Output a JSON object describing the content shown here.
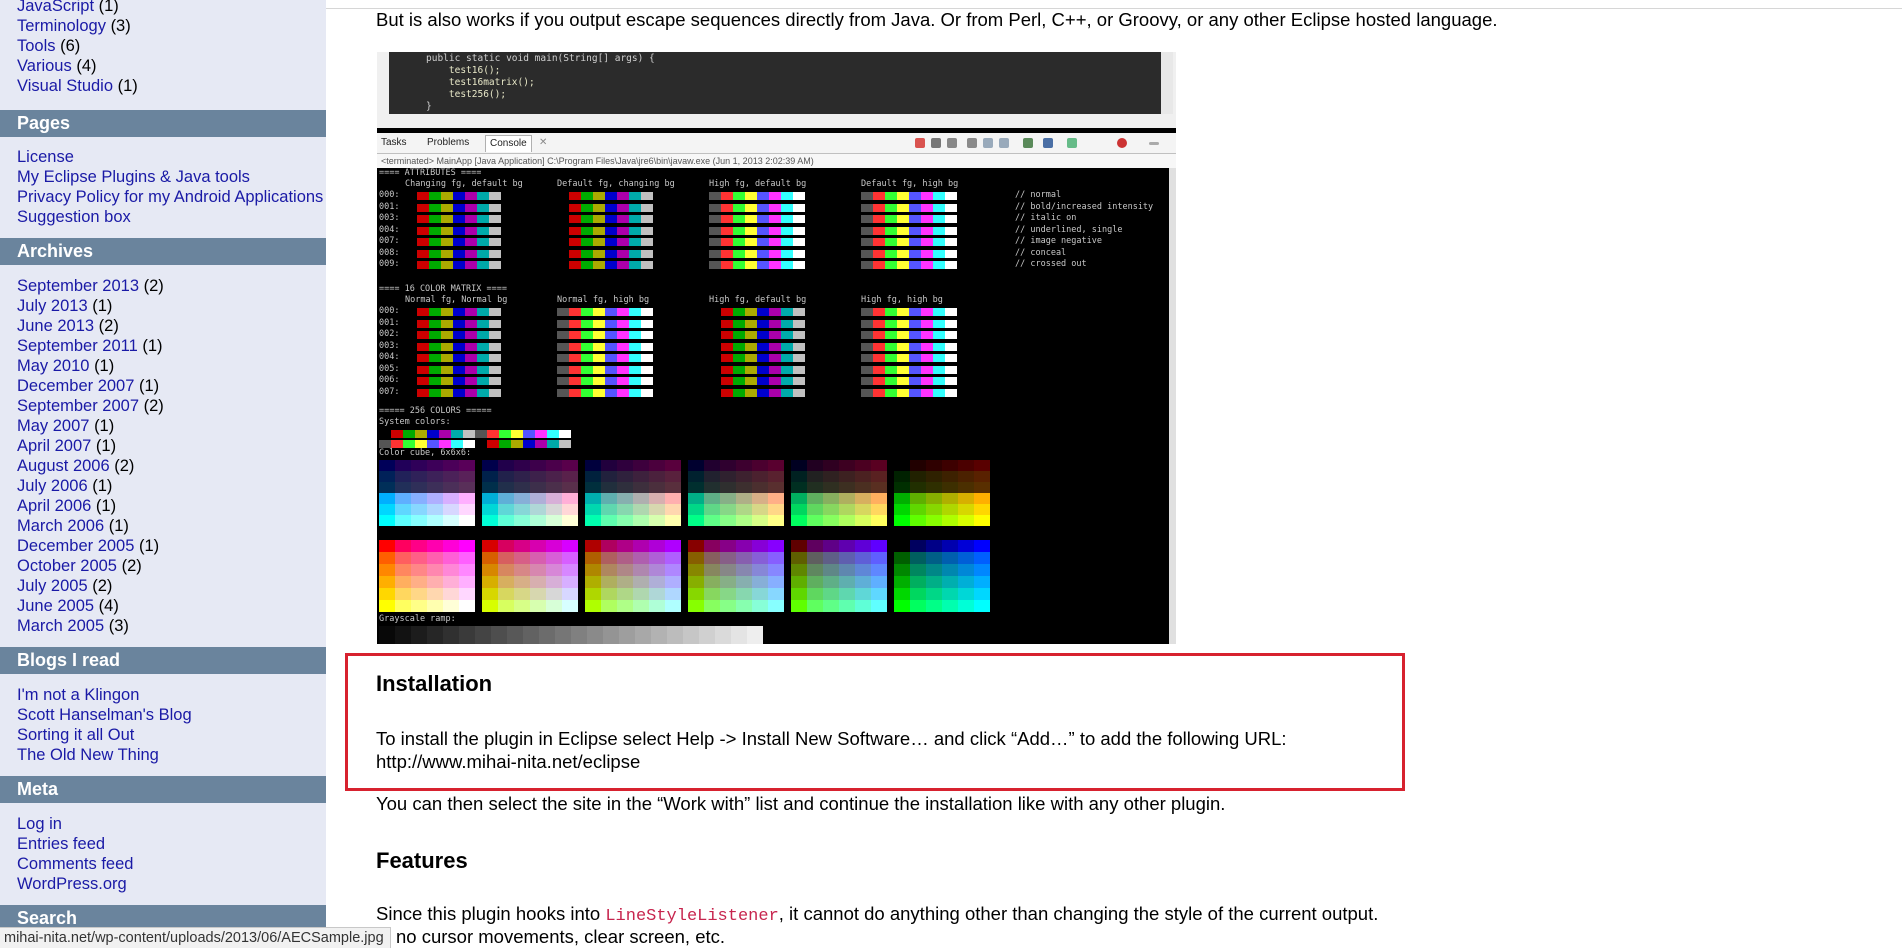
{
  "sidebar": {
    "categories": [
      {
        "label": "JavaScript",
        "count": "(1)"
      },
      {
        "label": "Terminology",
        "count": "(3)"
      },
      {
        "label": "Tools",
        "count": "(6)"
      },
      {
        "label": "Various",
        "count": "(4)"
      },
      {
        "label": "Visual Studio",
        "count": "(1)"
      }
    ],
    "pages_heading": "Pages",
    "pages": [
      {
        "label": "License"
      },
      {
        "label": "My Eclipse Plugins & Java tools"
      },
      {
        "label": "Privacy Policy for my Android Applications"
      },
      {
        "label": "Suggestion box"
      }
    ],
    "archives_heading": "Archives",
    "archives": [
      {
        "label": "September 2013",
        "count": "(2)"
      },
      {
        "label": "July 2013",
        "count": "(1)"
      },
      {
        "label": "June 2013",
        "count": "(2)"
      },
      {
        "label": "September 2011",
        "count": "(1)"
      },
      {
        "label": "May 2010",
        "count": "(1)"
      },
      {
        "label": "December 2007",
        "count": "(1)"
      },
      {
        "label": "September 2007",
        "count": "(2)"
      },
      {
        "label": "May 2007",
        "count": "(1)"
      },
      {
        "label": "April 2007",
        "count": "(1)"
      },
      {
        "label": "August 2006",
        "count": "(2)"
      },
      {
        "label": "July 2006",
        "count": "(1)"
      },
      {
        "label": "April 2006",
        "count": "(1)"
      },
      {
        "label": "March 2006",
        "count": "(1)"
      },
      {
        "label": "December 2005",
        "count": "(1)"
      },
      {
        "label": "October 2005",
        "count": "(2)"
      },
      {
        "label": "July 2005",
        "count": "(2)"
      },
      {
        "label": "June 2005",
        "count": "(4)"
      },
      {
        "label": "March 2005",
        "count": "(3)"
      }
    ],
    "blogs_heading": "Blogs I read",
    "blogs": [
      {
        "label": "I'm not a Klingon"
      },
      {
        "label": "Scott Hanselman's Blog"
      },
      {
        "label": "Sorting it all Out"
      },
      {
        "label": "The Old New Thing"
      }
    ],
    "meta_heading": "Meta",
    "meta": [
      {
        "label": "Log in"
      },
      {
        "label": "Entries feed"
      },
      {
        "label": "Comments feed"
      },
      {
        "label": "WordPress.org"
      }
    ],
    "search_heading": "Search"
  },
  "status_url": "mihai-nita.net/wp-content/uploads/2013/06/AECSample.jpg",
  "content": {
    "intro": "But is also works if you output escape sequences directly from Java. Or from Perl, C++, or Groovy, or any other Eclipse hosted language.",
    "installation_heading": "Installation",
    "install_text_1": "To install the plugin in Eclipse select Help -> Install New Software… and click “Add…” to add the following URL:",
    "install_url": "http://www.mihai-nita.net/eclipse",
    "install_text_2": "You can then select the site in the “Work with” list and continue the installation like with any other plugin.",
    "features_heading": "Features",
    "features_pre": "Since this plugin hooks into ",
    "features_code": "LineStyleListener",
    "features_post": ", it cannot do anything other than changing the style of the current output.",
    "features_line2": "no cursor movements, clear screen, etc."
  },
  "screenshot": {
    "code_lines": [
      "public static void main(String[] args) {",
      "    test16();",
      "    test16matrix();",
      "    test256();",
      "}"
    ],
    "tabs": [
      "Tasks",
      "Problems",
      "Console"
    ],
    "terminated": "<terminated> MainApp [Java Application] C:\\Program Files\\Java\\jre6\\bin\\javaw.exe (Jun 1, 2013 2:02:39 AM)",
    "attributes_header": "==== ATTRIBUTES ====",
    "attr_col_titles": [
      "Changing fg, default bg",
      "Default fg, changing bg",
      "High fg, default bg",
      "Default fg, high bg"
    ],
    "row_labels": [
      "000:",
      "001:",
      "003:",
      "004:",
      "007:",
      "008:",
      "009:"
    ],
    "attr_comments": [
      "// normal",
      "// bold/increased intensity",
      "// italic on",
      "// underlined, single",
      "// image negative",
      "// conceal",
      "// crossed out"
    ],
    "matrix_header": "==== 16 COLOR MATRIX ====",
    "matrix_col_titles": [
      "Normal fg, Normal bg",
      "Normal fg, high bg",
      "High fg, default bg",
      "High fg, high bg"
    ],
    "matrix_row_labels": [
      "000:",
      "001:",
      "002:",
      "003:",
      "004:",
      "005:",
      "006:",
      "007:"
    ],
    "colors256_header": "===== 256 COLORS =====",
    "system_colors": "System colors:",
    "color_cube": "Color cube, 6x6x6:",
    "grayscale": "Grayscale ramp:"
  },
  "colors": {
    "sidebar_bg": "#e6e9f4",
    "heading_bg": "#6a849d",
    "link": "#1a1aa6",
    "highlight_border": "#d7222f"
  }
}
